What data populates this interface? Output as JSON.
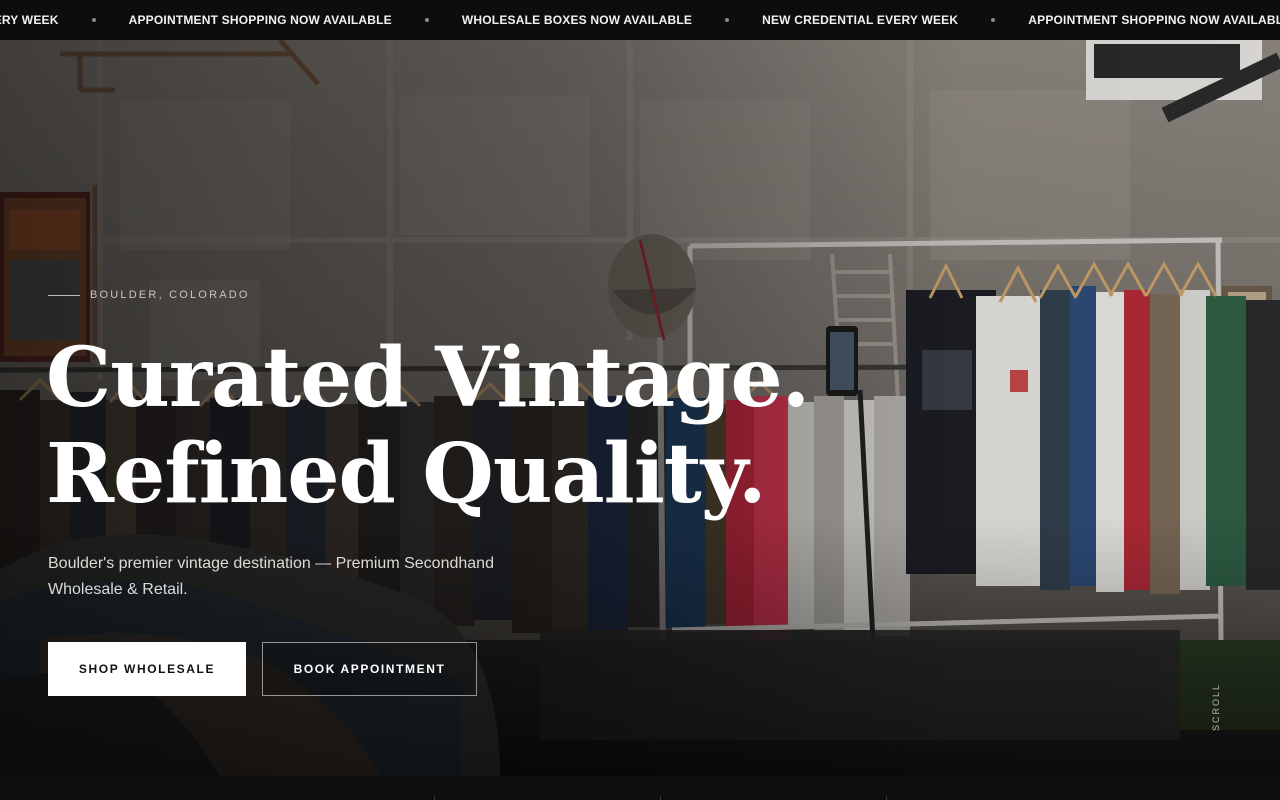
{
  "ticker": {
    "items": [
      "IAL EVERY WEEK",
      "APPOINTMENT SHOPPING NOW AVAILABLE",
      "WHOLESALE BOXES NOW AVAILABLE",
      "NEW CREDENTIAL EVERY WEEK",
      "APPOINTMENT SHOPPING NOW AVAILABLE"
    ]
  },
  "hero": {
    "eyebrow": "BOULDER, COLORADO",
    "headline_line1": "Curated Vintage.",
    "headline_line2": "Refined Quality.",
    "subtitle": "Boulder's premier vintage destination — Premium Secondhand Wholesale & Retail.",
    "primary_button": "SHOP WHOLESALE",
    "secondary_button": "BOOK APPOINTMENT",
    "scroll_label": "SCROLL"
  }
}
